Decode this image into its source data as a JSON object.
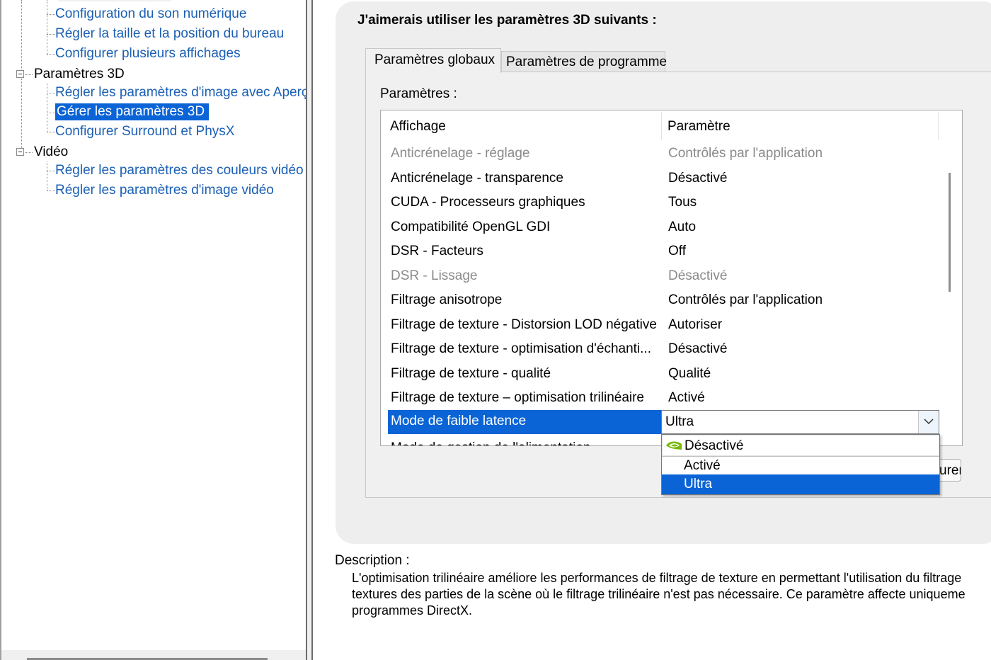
{
  "tree": {
    "items": [
      {
        "label": "Configuration du son numérique",
        "type": "link"
      },
      {
        "label": "Régler la taille et la position du bureau",
        "type": "link"
      },
      {
        "label": "Configurer plusieurs affichages",
        "type": "link"
      },
      {
        "label": "Paramètres 3D",
        "type": "category"
      },
      {
        "label": "Régler les paramètres d'image avec Aperçu",
        "type": "link"
      },
      {
        "label": "Gérer les paramètres 3D",
        "type": "link",
        "selected": true
      },
      {
        "label": "Configurer Surround et PhysX",
        "type": "link"
      },
      {
        "label": "Vidéo",
        "type": "category"
      },
      {
        "label": "Régler les paramètres des couleurs vidéo",
        "type": "link"
      },
      {
        "label": "Régler les paramètres d'image vidéo",
        "type": "link"
      }
    ]
  },
  "main": {
    "heading": "J'aimerais utiliser les paramètres 3D suivants :",
    "tabs": [
      {
        "label": "Paramètres globaux",
        "active": true
      },
      {
        "label": "Paramètres de programme",
        "active": false
      }
    ],
    "params_label": "Paramètres :",
    "columns": {
      "feature": "Affichage",
      "setting": "Paramètre"
    },
    "rows": [
      {
        "feature": "Anticrénelage - réglage",
        "setting": "Contrôlés par l'application",
        "disabled": true
      },
      {
        "feature": "Anticrénelage - transparence",
        "setting": "Désactivé"
      },
      {
        "feature": "CUDA - Processeurs graphiques",
        "setting": "Tous"
      },
      {
        "feature": "Compatibilité OpenGL GDI",
        "setting": "Auto"
      },
      {
        "feature": "DSR - Facteurs",
        "setting": "Off"
      },
      {
        "feature": "DSR - Lissage",
        "setting": "Désactivé",
        "disabled": true
      },
      {
        "feature": "Filtrage anisotrope",
        "setting": "Contrôlés par l'application"
      },
      {
        "feature": "Filtrage de texture - Distorsion LOD négative",
        "setting": "Autoriser"
      },
      {
        "feature": "Filtrage de texture - optimisation d'échanti...",
        "setting": "Désactivé"
      },
      {
        "feature": "Filtrage de texture - qualité",
        "setting": "Qualité"
      },
      {
        "feature": "Filtrage de texture – optimisation trilinéaire",
        "setting": "Activé"
      }
    ],
    "selected_row": {
      "feature": "Mode de faible latence",
      "setting": "Ultra"
    },
    "partial_row": "Mode de gestion de l'alimentation",
    "dropdown_options": [
      {
        "label": "Désactivé",
        "icon": "nvidia-logo-icon"
      },
      {
        "label": "Activé"
      },
      {
        "label": "Ultra",
        "highlighted": true
      }
    ],
    "restore_button_partial": "urer"
  },
  "description": {
    "label": "Description :",
    "text": "L'optimisation trilinéaire améliore les performances de filtrage de texture en permettant l'utilisation du filtrage\ntextures des parties de la scène où le filtrage trilinéaire n'est pas nécessaire. Ce paramètre affecte uniqueme\nprogrammes DirectX."
  },
  "colors": {
    "selection": "#0a64d6",
    "link": "#1a5fb4",
    "panel_bg": "#eeeeee",
    "disabled_text": "#8a8a8a"
  }
}
